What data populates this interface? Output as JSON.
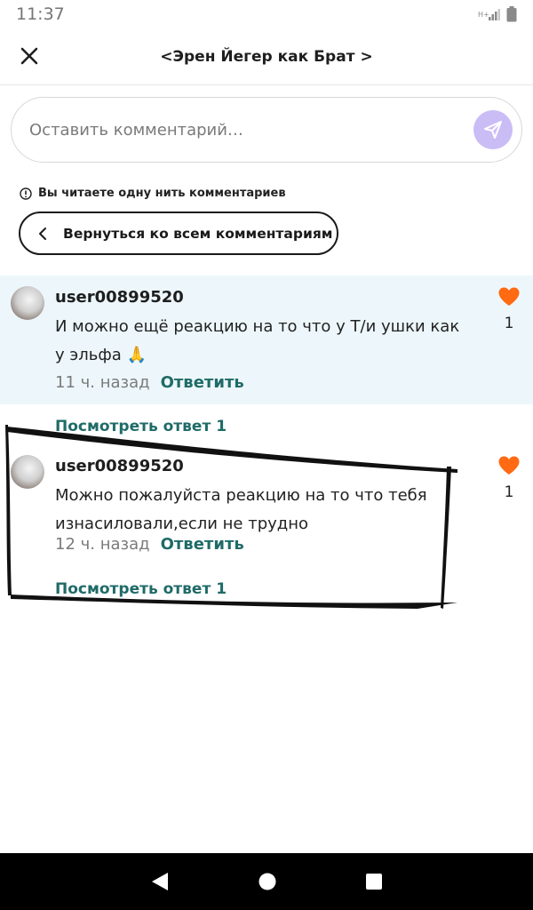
{
  "status_bar": {
    "time": "11:37"
  },
  "header": {
    "title": "<Эрен Йегер как Брат >"
  },
  "comment_input": {
    "placeholder": "Оставить комментарий…"
  },
  "thread_note": "Вы читаете одну нить комментариев",
  "back_button": {
    "label": "Вернуться ко всем комментариям"
  },
  "comments": [
    {
      "username": "user00899520",
      "text": "И можно ещё реакцию на то что у Т/и ушки как у эльфа 🙏",
      "time": "11 ч. назад",
      "reply_label": "Ответить",
      "likes": "1",
      "view_replies": "Посмотреть ответ 1"
    },
    {
      "username": "user00899520",
      "text": "Можно пожалуйста реакцию на то что тебя изнасиловали,если не трудно",
      "time": "12 ч. назад",
      "reply_label": "Ответить",
      "likes": "1",
      "view_replies": "Посмотреть ответ 1"
    }
  ],
  "colors": {
    "accent_teal": "#1f6b68",
    "like_orange": "#ff6a13",
    "send_button": "#cabdf6",
    "highlight_bg": "#edf7fb"
  },
  "icons": [
    "close-icon",
    "send-icon",
    "info-icon",
    "chevron-left-icon",
    "heart-icon",
    "back-triangle-icon",
    "home-circle-icon",
    "recents-square-icon"
  ]
}
